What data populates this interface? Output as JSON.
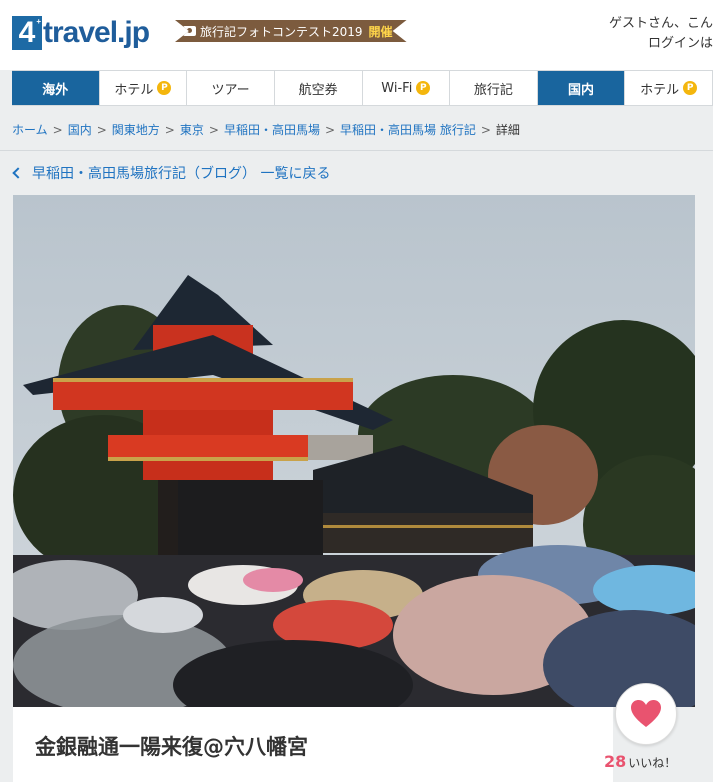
{
  "header": {
    "logo_digit": "4",
    "logo_text": "travel.jp",
    "contest_label": "旅行記フォトコンテスト2019",
    "contest_status": "開催",
    "guest_greeting": "ゲストさん、こん",
    "login_label": "ログインは"
  },
  "nav": {
    "items": [
      {
        "label": "海外"
      },
      {
        "label": "ホテル"
      },
      {
        "label": "ツアー"
      },
      {
        "label": "航空券"
      },
      {
        "label": "Wi-Fi"
      },
      {
        "label": "旅行記"
      },
      {
        "label": "国内"
      },
      {
        "label": "ホテル"
      }
    ],
    "points_badge": "P"
  },
  "breadcrumb": {
    "items": [
      "ホーム",
      "国内",
      "関東地方",
      "東京",
      "早稲田・高田馬場",
      "早稲田・高田馬場 旅行記"
    ],
    "current": "詳細",
    "separator": ">"
  },
  "back_link": "早稲田・高田馬場旅行記（ブログ） 一覧に戻る",
  "travelogue": {
    "title": "金銀融通一陽来復@穴八幡宮",
    "like_count": "28",
    "like_label": "いいね！"
  },
  "colors": {
    "brand_blue": "#19659e",
    "link_blue": "#1f73c1",
    "like_pink": "#e9536f",
    "shrine_red": "#d6321f"
  }
}
